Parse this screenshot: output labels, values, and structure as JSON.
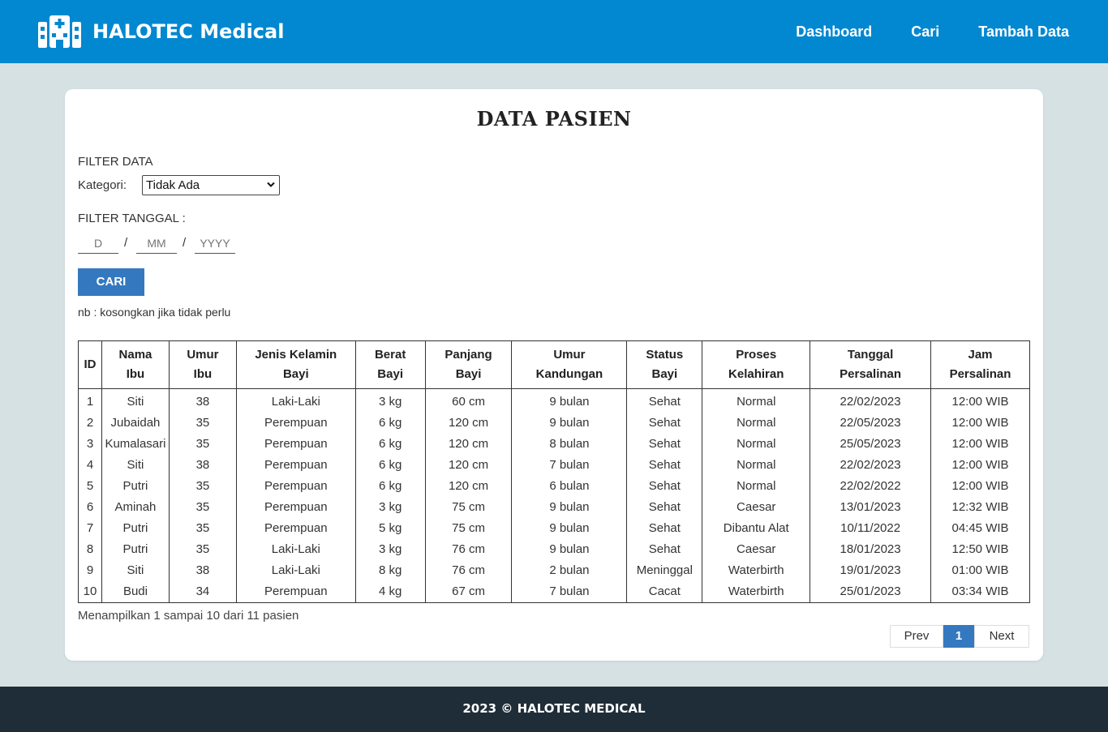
{
  "brand": {
    "name": "HALOTEC Medical",
    "icon": "hospital-icon",
    "color": "#0288d1"
  },
  "nav": {
    "links": [
      "Dashboard",
      "Cari",
      "Tambah Data"
    ]
  },
  "page": {
    "title": "DATA PASIEN"
  },
  "filter": {
    "section_label": "FILTER DATA",
    "kategori_label": "Kategori:",
    "kategori_value": "Tidak Ada",
    "tanggal_label": "FILTER TANGGAL :",
    "day_placeholder": "D",
    "month_placeholder": "MM",
    "year_placeholder": "YYYY",
    "separator": "/",
    "button": "CARI",
    "note": "nb : kosongkan jika tidak perlu"
  },
  "table": {
    "headers": [
      [
        "ID"
      ],
      [
        "Nama",
        "Ibu"
      ],
      [
        "Umur",
        "Ibu"
      ],
      [
        "Jenis Kelamin",
        "Bayi"
      ],
      [
        "Berat",
        "Bayi"
      ],
      [
        "Panjang",
        "Bayi"
      ],
      [
        "Umur",
        "Kandungan"
      ],
      [
        "Status",
        "Bayi"
      ],
      [
        "Proses",
        "Kelahiran"
      ],
      [
        "Tanggal",
        "Persalinan"
      ],
      [
        "Jam",
        "Persalinan"
      ]
    ],
    "rows": [
      [
        "1",
        "Siti",
        "38",
        "Laki-Laki",
        "3 kg",
        "60 cm",
        "9 bulan",
        "Sehat",
        "Normal",
        "22/02/2023",
        "12:00 WIB"
      ],
      [
        "2",
        "Jubaidah",
        "35",
        "Perempuan",
        "6 kg",
        "120 cm",
        "9 bulan",
        "Sehat",
        "Normal",
        "22/05/2023",
        "12:00 WIB"
      ],
      [
        "3",
        "Kumalasari",
        "35",
        "Perempuan",
        "6 kg",
        "120 cm",
        "8 bulan",
        "Sehat",
        "Normal",
        "25/05/2023",
        "12:00 WIB"
      ],
      [
        "4",
        "Siti",
        "38",
        "Perempuan",
        "6 kg",
        "120 cm",
        "7 bulan",
        "Sehat",
        "Normal",
        "22/02/2023",
        "12:00 WIB"
      ],
      [
        "5",
        "Putri",
        "35",
        "Perempuan",
        "6 kg",
        "120 cm",
        "6 bulan",
        "Sehat",
        "Normal",
        "22/02/2022",
        "12:00 WIB"
      ],
      [
        "6",
        "Aminah",
        "35",
        "Perempuan",
        "3 kg",
        "75 cm",
        "9 bulan",
        "Sehat",
        "Caesar",
        "13/01/2023",
        "12:32 WIB"
      ],
      [
        "7",
        "Putri",
        "35",
        "Perempuan",
        "5 kg",
        "75 cm",
        "9 bulan",
        "Sehat",
        "Dibantu Alat",
        "10/11/2022",
        "04:45 WIB"
      ],
      [
        "8",
        "Putri",
        "35",
        "Laki-Laki",
        "3 kg",
        "76 cm",
        "9 bulan",
        "Sehat",
        "Caesar",
        "18/01/2023",
        "12:50 WIB"
      ],
      [
        "9",
        "Siti",
        "38",
        "Laki-Laki",
        "8 kg",
        "76 cm",
        "2 bulan",
        "Meninggal",
        "Waterbirth",
        "19/01/2023",
        "01:00 WIB"
      ],
      [
        "10",
        "Budi",
        "34",
        "Perempuan",
        "4 kg",
        "67 cm",
        "7 bulan",
        "Cacat",
        "Waterbirth",
        "25/01/2023",
        "03:34 WIB"
      ]
    ]
  },
  "pagination": {
    "info": "Menampilkan 1 sampai 10 dari 11 pasien",
    "prev": "Prev",
    "current": "1",
    "next": "Next",
    "accent": "#3479c0"
  },
  "footer": {
    "text": "2023 © HALOTEC MEDICAL",
    "background": "#1f2d38"
  }
}
